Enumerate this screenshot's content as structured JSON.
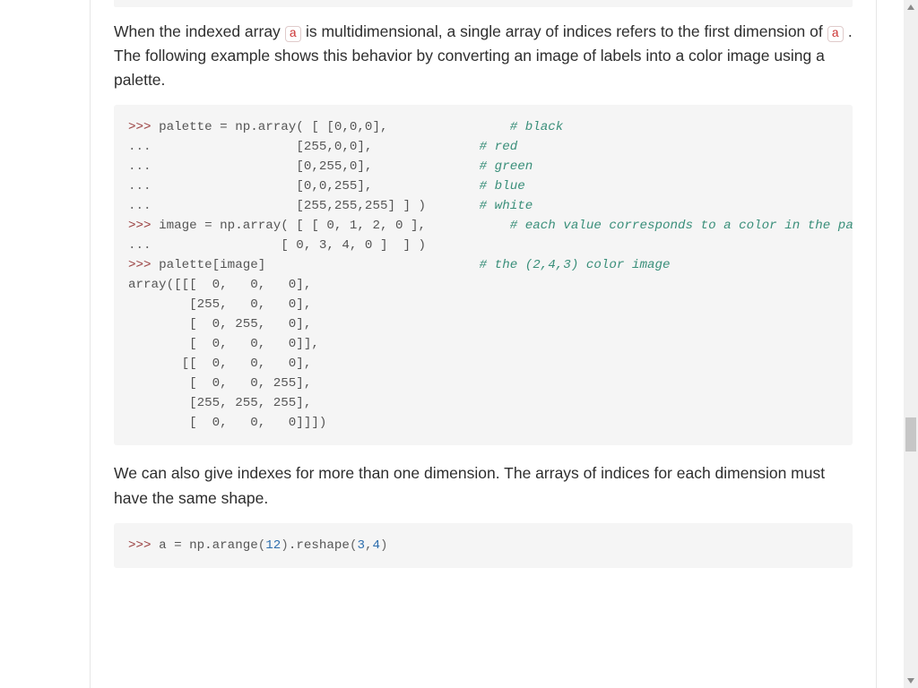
{
  "para1": {
    "seg1": "When the indexed array ",
    "code1": "a",
    "seg2": " is multidimensional, a single array of indices refers to the first dimension of ",
    "code2": "a",
    "seg3": " . The following example shows this behavior by converting an image of labels into a color image using a palette."
  },
  "code1": {
    "l01_prompt": ">>> ",
    "l01_rest": "palette = np.array( [ [0,0,0],                ",
    "l01_comment": "# black",
    "l02_cont": "...                   ",
    "l02_rest": "[255,0,0],              ",
    "l02_comment": "# red",
    "l03_cont": "...                   ",
    "l03_rest": "[0,255,0],              ",
    "l03_comment": "# green",
    "l04_cont": "...                   ",
    "l04_rest": "[0,0,255],              ",
    "l04_comment": "# blue",
    "l05_cont": "...                   ",
    "l05_rest": "[255,255,255] ] )       ",
    "l05_comment": "# white",
    "l06_prompt": ">>> ",
    "l06_rest": "image = np.array( [ [ 0, 1, 2, 0 ],           ",
    "l06_comment": "# each value corresponds to a color in the palette",
    "l07_cont": "...                 ",
    "l07_rest": "[ 0, 3, 4, 0 ]  ] )",
    "l08_prompt": ">>> ",
    "l08_rest": "palette[image]                            ",
    "l08_comment": "# the (2,4,3) color image",
    "l09_out": "array([[[  0,   0,   0],",
    "l10_out": "        [255,   0,   0],",
    "l11_out": "        [  0, 255,   0],",
    "l12_out": "        [  0,   0,   0]],",
    "l13_out": "       [[  0,   0,   0],",
    "l14_out": "        [  0,   0, 255],",
    "l15_out": "        [255, 255, 255],",
    "l16_out": "        [  0,   0,   0]]])"
  },
  "para2": "We can also give indexes for more than one dimension. The arrays of indices for each dimension must have the same shape.",
  "code2": {
    "l01_prompt": ">>> ",
    "l01_a": "a = np.arange",
    "l01_p1": "(",
    "l01_n1": "12",
    "l01_p2": ")",
    "l01_b": ".reshape",
    "l01_p3": "(",
    "l01_n2": "3",
    "l01_c": ",",
    "l01_n3": "4",
    "l01_p4": ")"
  }
}
